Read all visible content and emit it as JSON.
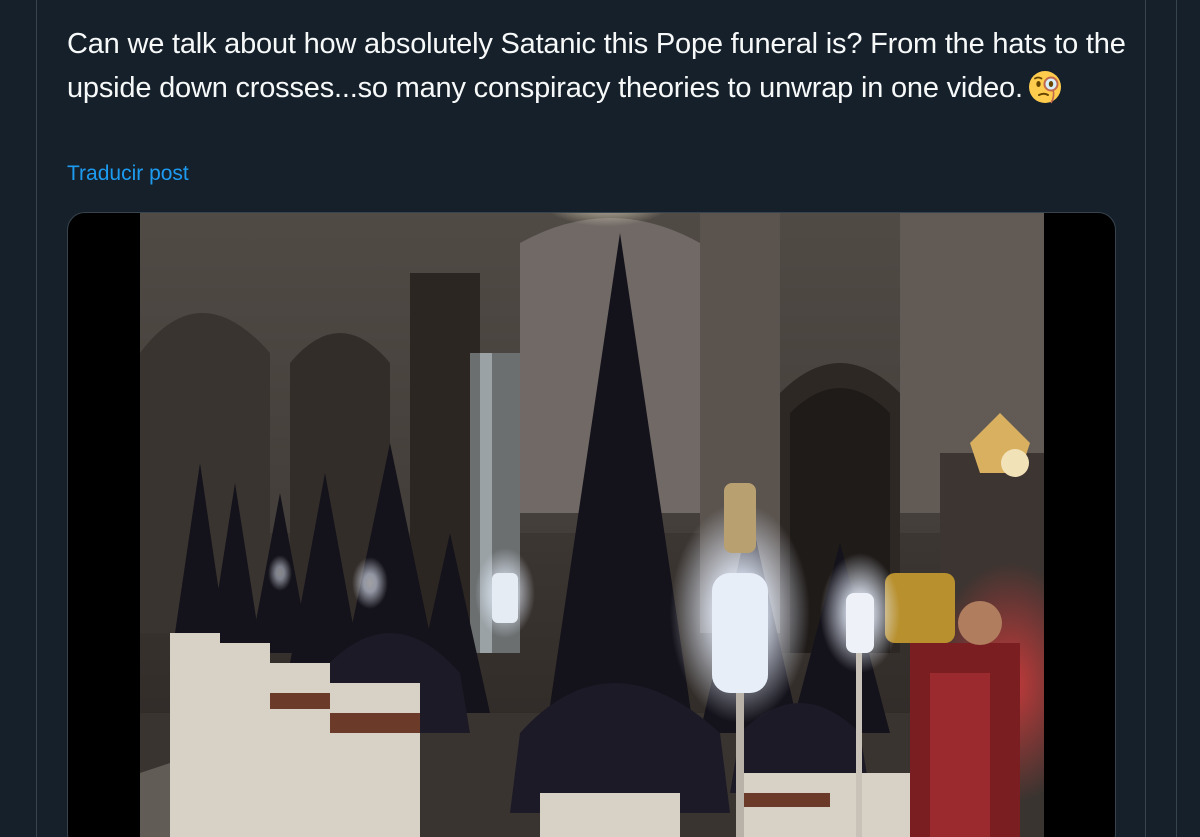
{
  "post": {
    "text": "Can we talk about how absolutely Satanic this Pope funeral is? From the hats to the upside down crosses...so many conspiracy theories to unwrap in one video.",
    "emoji_icon": "face-with-monocle-emoji",
    "translate_label": "Traducir post"
  },
  "media": {
    "type": "video",
    "description_icon": "procession-video-frame"
  },
  "colors": {
    "background": "#15202b",
    "border": "#38444d",
    "text": "#f7f9f9",
    "link": "#1d9bf0"
  }
}
